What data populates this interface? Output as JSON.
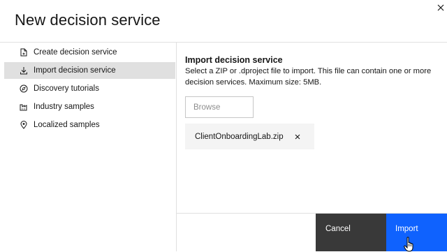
{
  "dialog": {
    "title": "New decision service",
    "close_icon": "close-icon"
  },
  "nav": {
    "items": [
      {
        "label": "Create decision service",
        "icon": "new-file-icon",
        "selected": false
      },
      {
        "label": "Import decision service",
        "icon": "download-icon",
        "selected": true
      },
      {
        "label": "Discovery tutorials",
        "icon": "compass-icon",
        "selected": false
      },
      {
        "label": "Industry samples",
        "icon": "industry-icon",
        "selected": false
      },
      {
        "label": "Localized samples",
        "icon": "location-icon",
        "selected": false
      }
    ]
  },
  "import": {
    "title": "Import decision service",
    "description": "Select a ZIP or .dproject file to import. This file can contain one or more decision services. Maximum size: 5MB.",
    "browse_label": "Browse",
    "file_name": "ClientOnboardingLab.zip"
  },
  "footer": {
    "cancel_label": "Cancel",
    "import_label": "Import"
  },
  "colors": {
    "primary": "#0f62fe",
    "secondary": "#393939",
    "selected_bg": "#e0e0e0",
    "chip_bg": "#f4f4f4"
  }
}
